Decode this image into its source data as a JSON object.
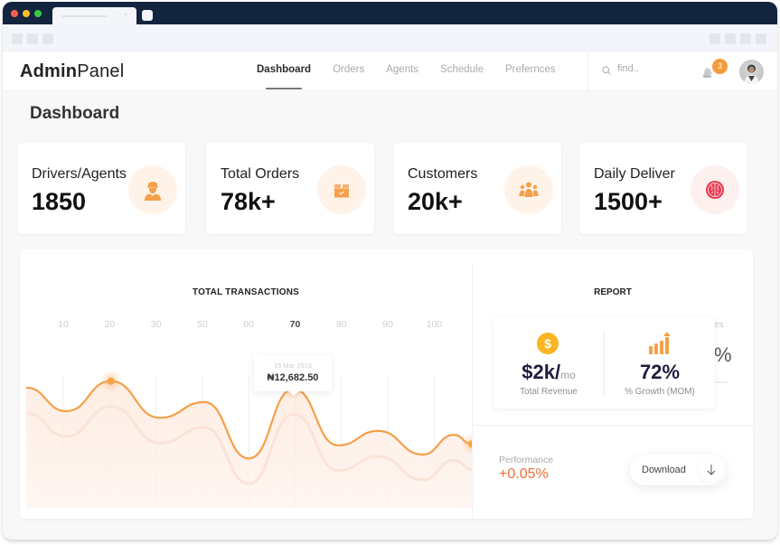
{
  "browser": {
    "tab_close_glyph": "×"
  },
  "header": {
    "logo_bold": "Admin",
    "logo_light": "Panel",
    "nav": [
      {
        "label": "Dashboard",
        "active": true
      },
      {
        "label": "Orders",
        "active": false
      },
      {
        "label": "Agents",
        "active": false
      },
      {
        "label": "Schedule",
        "active": false
      },
      {
        "label": "Prefernces",
        "active": false
      }
    ],
    "search_placeholder": "find..",
    "notification_count": "3"
  },
  "page": {
    "title": "Dashboard"
  },
  "stats": [
    {
      "label": "Drivers/Agents",
      "value": "1850",
      "icon": "driver-icon"
    },
    {
      "label": "Total Orders",
      "value": "78k+",
      "icon": "box-icon"
    },
    {
      "label": "Customers",
      "value": "20k+",
      "icon": "users-icon"
    },
    {
      "label": "Daily Deliver",
      "value": "1500+",
      "icon": "brain-icon"
    }
  ],
  "transactions": {
    "title": "TOTAL TRANSACTIONS",
    "x_ticks": [
      "10",
      "20",
      "30",
      "50",
      "60",
      "70",
      "80",
      "90",
      "100"
    ],
    "active_tick": "70",
    "tooltip_date": "15 Mar 2018",
    "tooltip_value": "₦12,682.50",
    "accent_color": "#f5a04a"
  },
  "chart_data": {
    "type": "line",
    "title": "TOTAL TRANSACTIONS",
    "categories": [
      "10",
      "20",
      "30",
      "50",
      "60",
      "70",
      "80",
      "90",
      "100"
    ],
    "series": [
      {
        "name": "transactions",
        "values": [
          {
            "t": 0.0,
            "v": 0.78
          },
          {
            "t": 0.09,
            "v": 0.6
          },
          {
            "t": 0.19,
            "v": 0.83
          },
          {
            "t": 0.3,
            "v": 0.55
          },
          {
            "t": 0.4,
            "v": 0.67
          },
          {
            "t": 0.5,
            "v": 0.24
          },
          {
            "t": 0.6,
            "v": 0.77
          },
          {
            "t": 0.7,
            "v": 0.34
          },
          {
            "t": 0.79,
            "v": 0.45
          },
          {
            "t": 0.89,
            "v": 0.27
          },
          {
            "t": 0.96,
            "v": 0.42
          },
          {
            "t": 1.0,
            "v": 0.35
          }
        ]
      }
    ],
    "highlight_points": [
      0.19,
      0.6,
      1.0
    ],
    "tooltip": {
      "date": "15 Mar 2018",
      "value": "₦12,682.50"
    },
    "grid": "vertical"
  },
  "report": {
    "title": "REPORT",
    "ghost_label": "es",
    "ghost_value": "%",
    "revenue_value": "$2k/",
    "revenue_unit": "mo",
    "revenue_label": "Total Revenue",
    "growth_value": "72%",
    "growth_label": "% Growth (MOM)",
    "performance_label": "Performance",
    "performance_value": "+0.05%",
    "download_label": "Download"
  }
}
